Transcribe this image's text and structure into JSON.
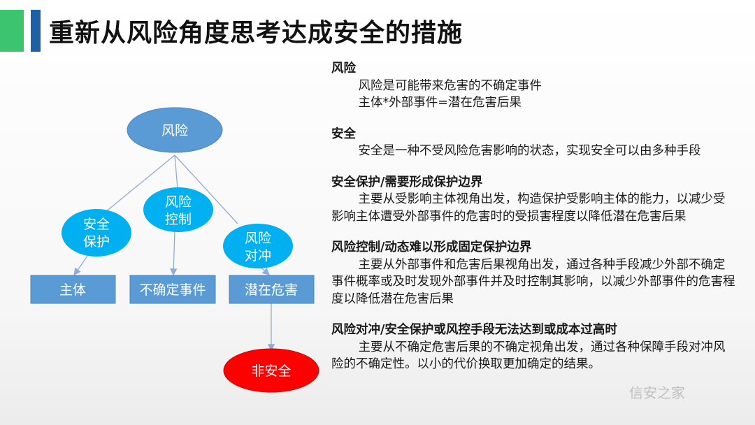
{
  "title": "重新从风险角度思考达成安全的措施",
  "diagram": {
    "nodes": {
      "risk": "风险",
      "safety_protect": [
        "安全",
        "保护"
      ],
      "risk_control": [
        "风险",
        "控制"
      ],
      "risk_hedge": [
        "风险",
        "对冲"
      ],
      "subject": "主体",
      "uncertain_event": "不确定事件",
      "potential_harm": "潜在危害",
      "unsafe": "非安全"
    },
    "colors": {
      "ellipse": "#5b9bd5",
      "circle": "#00b0f0",
      "box": "#5b9bd5",
      "unsafe": "#ff0000",
      "line": "#8faadc"
    }
  },
  "sections": [
    {
      "heading": "风险",
      "lines": [
        "风险是可能带来危害的不确定事件",
        "主体*外部事件=潜在危害后果"
      ]
    },
    {
      "heading": "安全",
      "para": "安全是一种不受风险危害影响的状态，实现安全可以由多种手段"
    },
    {
      "heading": "安全保护/需要形成保护边界",
      "para": "主要从受影响主体视角出发，构造保护受影响主体的能力，以减少受影响主体遭受外部事件的危害时的受损害程度以降低潜在危害后果"
    },
    {
      "heading": "风险控制/动态难以形成固定保护边界",
      "para": "主要从外部事件和危害后果视角出发，通过各种手段减少外部不确定事件概率或及时发现外部事件并及时控制其影响，以减少外部事件的危害程度以降低潜在危害后果"
    },
    {
      "heading": "风险对冲/安全保护或风控手段无法达到或成本过高时",
      "para": "主要从不确定危害后果的不确定视角出发，通过各种保障手段对冲风险的不确定性。以小的代价换取更加确定的结果。"
    }
  ],
  "watermark": "信安之家"
}
